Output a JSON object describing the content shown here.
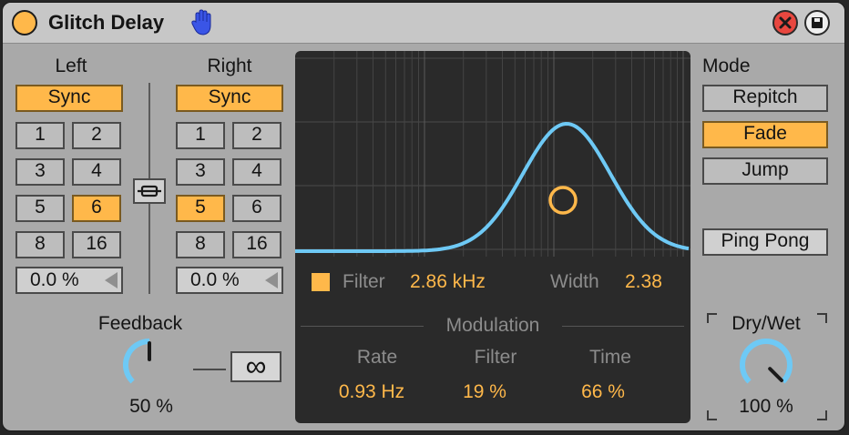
{
  "title": "Glitch Delay",
  "left": {
    "heading": "Left",
    "sync_label": "Sync",
    "beats": [
      "1",
      "2",
      "3",
      "4",
      "5",
      "6",
      "8",
      "16"
    ],
    "active_beat": "6",
    "offset": "0.0 %"
  },
  "right": {
    "heading": "Right",
    "sync_label": "Sync",
    "beats": [
      "1",
      "2",
      "3",
      "4",
      "5",
      "6",
      "8",
      "16"
    ],
    "active_beat": "5",
    "offset": "0.0 %"
  },
  "feedback": {
    "label": "Feedback",
    "value": "50 %",
    "level": 0.5,
    "freeze_symbol": "∞"
  },
  "filter": {
    "label": "Filter",
    "freq": "2.86 kHz",
    "width_label": "Width",
    "width": "2.38",
    "enabled": true
  },
  "modulation": {
    "heading": "Modulation",
    "rate_label": "Rate",
    "rate": "0.93 Hz",
    "filter_label": "Filter",
    "filter": "19 %",
    "time_label": "Time",
    "time": "66 %"
  },
  "mode": {
    "heading": "Mode",
    "options": [
      "Repitch",
      "Fade",
      "Jump"
    ],
    "active": "Fade",
    "ping_pong": "Ping Pong"
  },
  "drywet": {
    "label": "Dry/Wet",
    "value": "100 %",
    "level": 1.0
  },
  "colors": {
    "accent": "#ffb84a",
    "curve": "#6ec9f5",
    "panel": "#2a2a2a",
    "knob_track": "#6ec9f5"
  },
  "icons": {
    "power": "power-icon",
    "hand": "hand-icon",
    "close": "close-icon",
    "save": "save-icon",
    "link": "link-icon"
  }
}
